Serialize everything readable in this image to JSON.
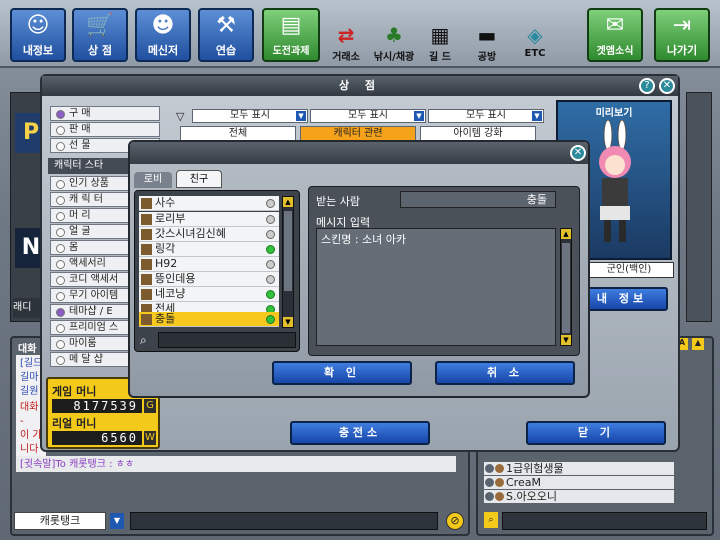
{
  "topbar": {
    "buttons": [
      {
        "label": "내정보",
        "icon": "user-icon"
      },
      {
        "label": "상  점",
        "icon": "cart-icon"
      },
      {
        "label": "메신저",
        "icon": "smiley-icon"
      },
      {
        "label": "연습",
        "icon": "dumbbell-icon"
      },
      {
        "label": "도전과제",
        "icon": "book-icon"
      }
    ],
    "small": [
      {
        "label": "거래소",
        "icon": "exchange-icon"
      },
      {
        "label": "낚시/채광",
        "icon": "palm-icon"
      },
      {
        "label": "길  드",
        "icon": "guild-icon"
      },
      {
        "label": "공방",
        "icon": "anvil-icon"
      },
      {
        "label": "ETC",
        "icon": "box-icon"
      }
    ],
    "right": [
      {
        "label": "겟앰소식",
        "icon": "news-icon"
      },
      {
        "label": "나가기",
        "icon": "exit-icon"
      }
    ]
  },
  "shop": {
    "title": "상  점",
    "modes": [
      "구  매",
      "판  매",
      "선  물"
    ],
    "category_header": "캐릭터 스타",
    "categories": [
      "인기 상품",
      "캐 릭 터",
      "머    리",
      "얼    굴",
      "몸",
      "액세서리",
      "코디 액세서",
      "무기 아이템",
      "테마샵 / E",
      "프리미엄 스",
      "마이룸",
      "메 달 샵"
    ],
    "filters": [
      "모두 표시",
      "모두 표시",
      "모두 표시"
    ],
    "tabs": [
      "전체",
      "캐릭터 관련",
      "아이템 강화"
    ],
    "preview_title": "미리보기",
    "preview_name": "군인(백인)",
    "my_info_btn": "내 정보",
    "charge_btn": "충전소",
    "close_btn": "닫  기"
  },
  "money": {
    "game_label": "게임 머니",
    "game_value": "8177539",
    "game_unit": "G",
    "real_label": "리얼 머니",
    "real_value": "6560",
    "real_unit": "W"
  },
  "left_panel": {
    "side_labels": [
      "P",
      "N",
      "래디"
    ],
    "chat_header": "대화",
    "chat_lines": [
      "[길드",
      "길마",
      "길원",
      "대화",
      "-",
      "이 가",
      "니다",
      "[귓속말]To 캐롯탱크 : ㅎㅎ"
    ],
    "channel": "캐롯탱크"
  },
  "gift": {
    "tabs": [
      "로비",
      "친구"
    ],
    "recipient_label": "받는 사람",
    "recipient_value": "충돌",
    "message_label": "메시지 입력",
    "message_value": "스킨명 : 소녀 아카",
    "confirm": "확  인",
    "cancel": "취  소",
    "friends": [
      {
        "name": "사수",
        "online": false
      },
      {
        "name": "로리부",
        "online": false
      },
      {
        "name": "갓스시녀김신혜",
        "online": false
      },
      {
        "name": "링각",
        "online": true
      },
      {
        "name": "H92",
        "online": false
      },
      {
        "name": "뜽인데용",
        "online": false
      },
      {
        "name": "네코냥",
        "online": true
      },
      {
        "name": "전세",
        "online": true
      },
      {
        "name": "충돌",
        "online": true
      }
    ]
  },
  "right_panel": {
    "list": [
      "1급위험생물",
      "CreaM",
      "S.아오오니"
    ]
  }
}
